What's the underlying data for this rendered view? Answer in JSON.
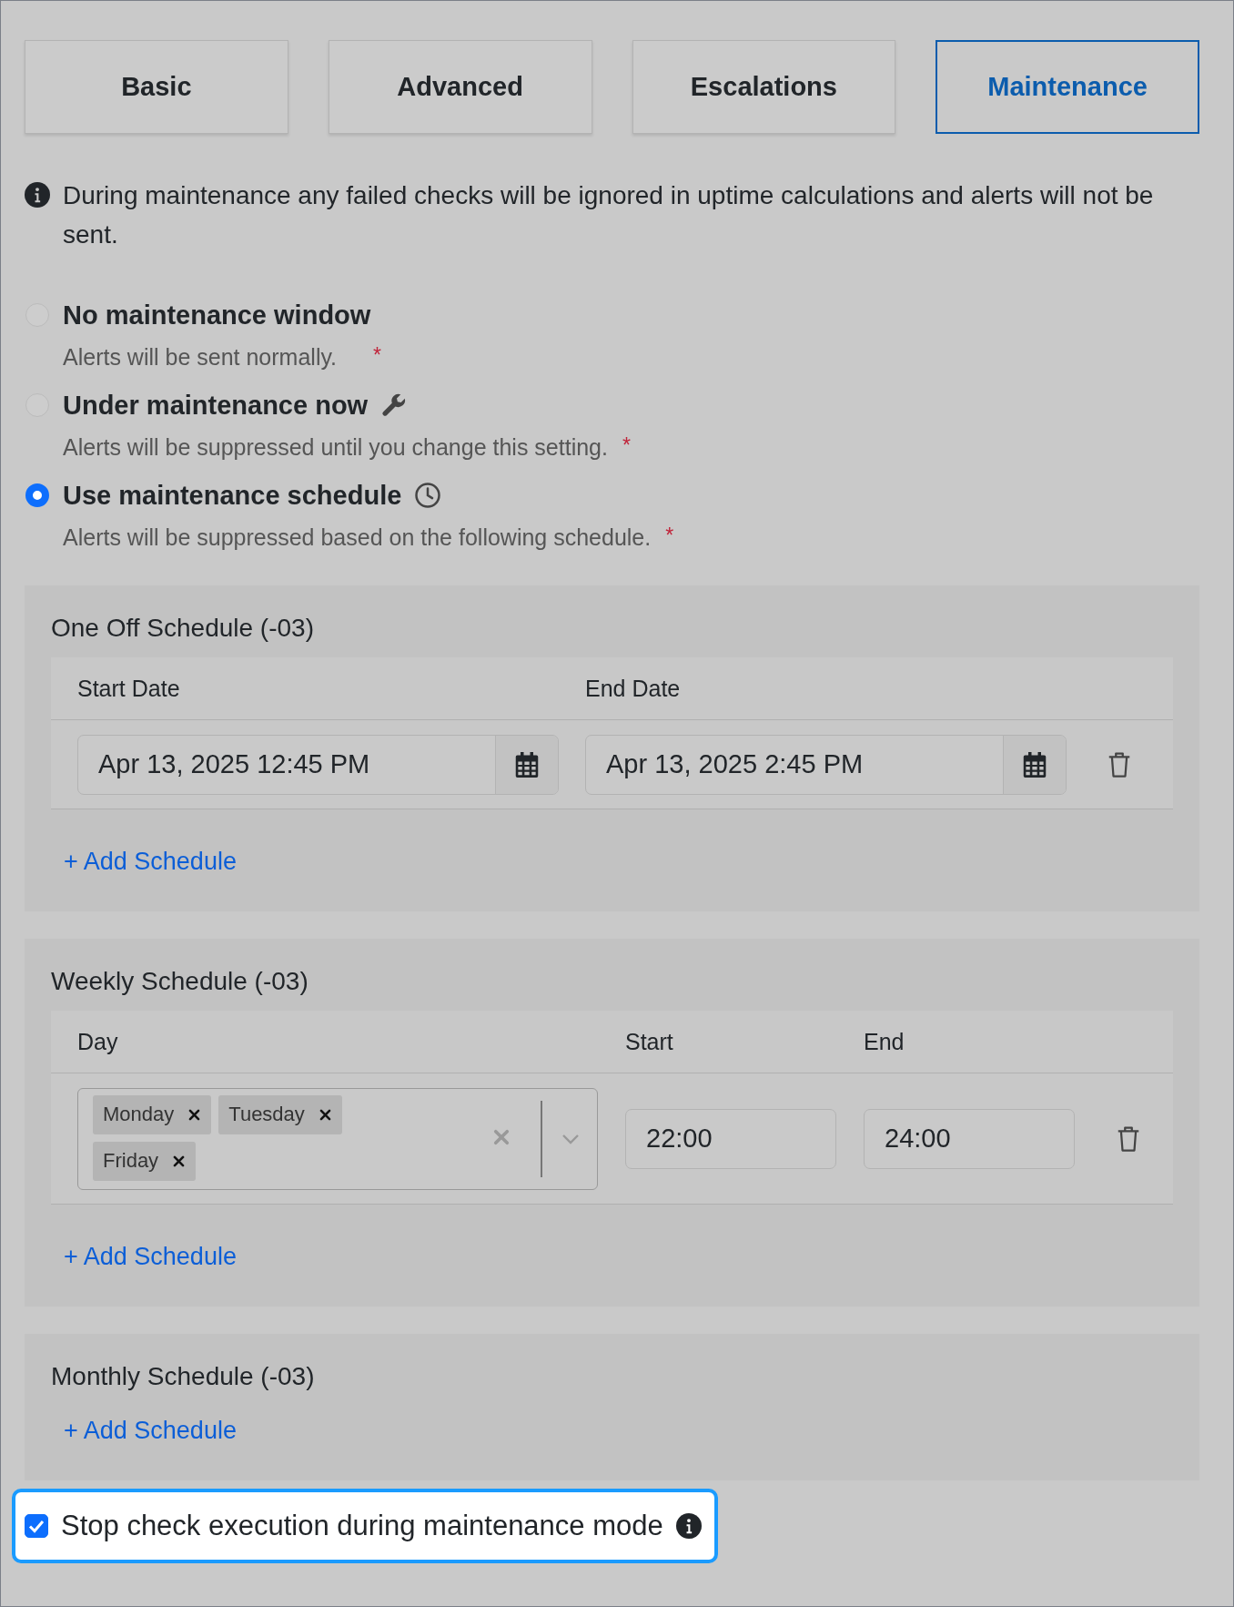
{
  "tabs": [
    {
      "label": "Basic",
      "selected": false
    },
    {
      "label": "Advanced",
      "selected": false
    },
    {
      "label": "Escalations",
      "selected": false
    },
    {
      "label": "Maintenance",
      "selected": true
    }
  ],
  "notice": "During maintenance any failed checks will be ignored in uptime calculations and alerts will not be sent.",
  "modes": [
    {
      "kind": "none",
      "label": "No maintenance window",
      "description": "Alerts will be sent normally.",
      "required_mark": "*",
      "selected": false
    },
    {
      "kind": "now",
      "label": "Under maintenance now",
      "description": "Alerts will be suppressed until you change this setting.",
      "required_mark": "*",
      "selected": false
    },
    {
      "kind": "schedule",
      "label": "Use maintenance schedule",
      "description": "Alerts will be suppressed based on the following schedule.",
      "required_mark": "*",
      "selected": true
    }
  ],
  "schedules": [
    {
      "kind": "one_off",
      "title": "One Off Schedule (-03)",
      "columns": [
        "Start Date",
        "End Date"
      ],
      "rows": [
        {
          "start": "Apr 13, 2025 12:45 PM",
          "end": "Apr 13, 2025 2:45 PM"
        }
      ],
      "add_label": "+ Add Schedule"
    },
    {
      "kind": "weekly",
      "title": "Weekly Schedule (-03)",
      "columns": [
        "Day",
        "Start",
        "End"
      ],
      "rows": [
        {
          "days": [
            "Monday",
            "Tuesday",
            "Friday"
          ],
          "start": "22:00",
          "end": "24:00"
        }
      ],
      "add_label": "+ Add Schedule"
    },
    {
      "kind": "monthly",
      "title": "Monthly Schedule (-03)",
      "add_label": "+ Add Schedule"
    }
  ],
  "stop_execution": {
    "label": "Stop check execution during maintenance mode",
    "checked": true
  }
}
